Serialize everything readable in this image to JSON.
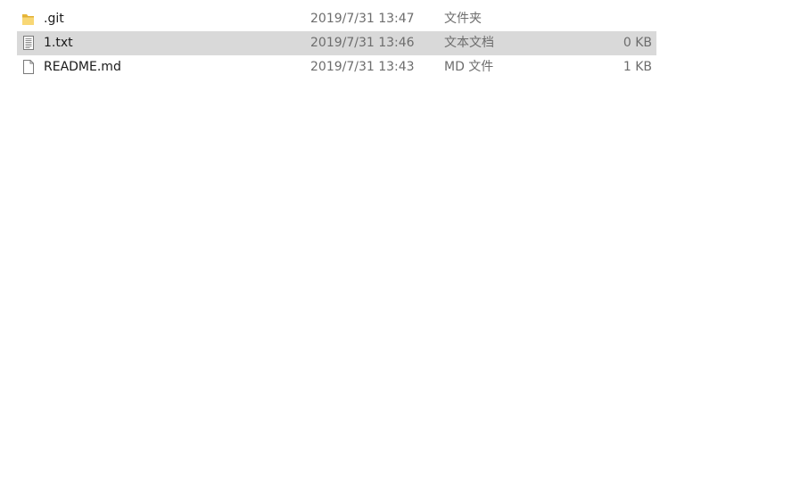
{
  "files": [
    {
      "name": ".git",
      "modified": "2019/7/31 13:47",
      "type": "文件夹",
      "size": "",
      "icon": "folder-icon",
      "selected": false
    },
    {
      "name": "1.txt",
      "modified": "2019/7/31 13:46",
      "type": "文本文档",
      "size": "0 KB",
      "icon": "text-document-icon",
      "selected": true
    },
    {
      "name": "README.md",
      "modified": "2019/7/31 13:43",
      "type": "MD 文件",
      "size": "1 KB",
      "icon": "blank-file-icon",
      "selected": false
    }
  ],
  "colors": {
    "selected_row": "#d9d9d9",
    "folder": "#f5c84c",
    "secondary_text": "#6d6d6d"
  }
}
